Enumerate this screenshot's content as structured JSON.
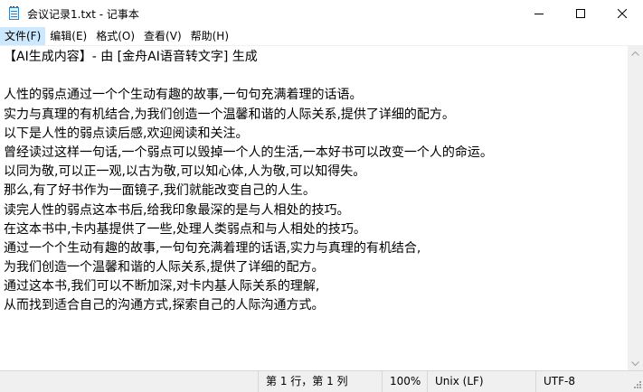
{
  "window": {
    "title": "会议记录1.txt - 记事本"
  },
  "menu": {
    "items": [
      {
        "label": "文件(F)",
        "active": true
      },
      {
        "label": "编辑(E)",
        "active": false
      },
      {
        "label": "格式(O)",
        "active": false
      },
      {
        "label": "查看(V)",
        "active": false
      },
      {
        "label": "帮助(H)",
        "active": false
      }
    ]
  },
  "document": {
    "lines": [
      "【AI生成内容】- 由 [金舟AI语音转文字] 生成",
      "",
      "人性的弱点通过一个个生动有趣的故事,一句句充满着理的话语。",
      "实力与真理的有机结合,为我们创造一个温馨和谐的人际关系,提供了详细的配方。",
      "以下是人性的弱点读后感,欢迎阅读和关注。",
      "曾经读过这样一句话,一个弱点可以毁掉一个人的生活,一本好书可以改变一个人的命运。",
      "以同为敬,可以正一观,以古为敬,可以知心体,人为敬,可以知得失。",
      "那么,有了好书作为一面镜子,我们就能改变自己的人生。",
      "读完人性的弱点这本书后,给我印象最深的是与人相处的技巧。",
      "在这本书中,卡内基提供了一些,处理人类弱点和与人相处的技巧。",
      "通过一个个生动有趣的故事,一句句充满着理的话语,实力与真理的有机结合,",
      "为我们创造一个温馨和谐的人际关系,提供了详细的配方。",
      "通过这本书,我们可以不断加深,对卡内基人际关系的理解,",
      "从而找到适合自己的沟通方式,探索自己的人际沟通方式。"
    ]
  },
  "status": {
    "position": "第 1 行，第 1 列",
    "zoom": "100%",
    "line_ending": "Unix (LF)",
    "encoding": "UTF-8"
  },
  "colors": {
    "menu_active": "#cce8ff",
    "statusbar_bg": "#f0f0f0"
  }
}
